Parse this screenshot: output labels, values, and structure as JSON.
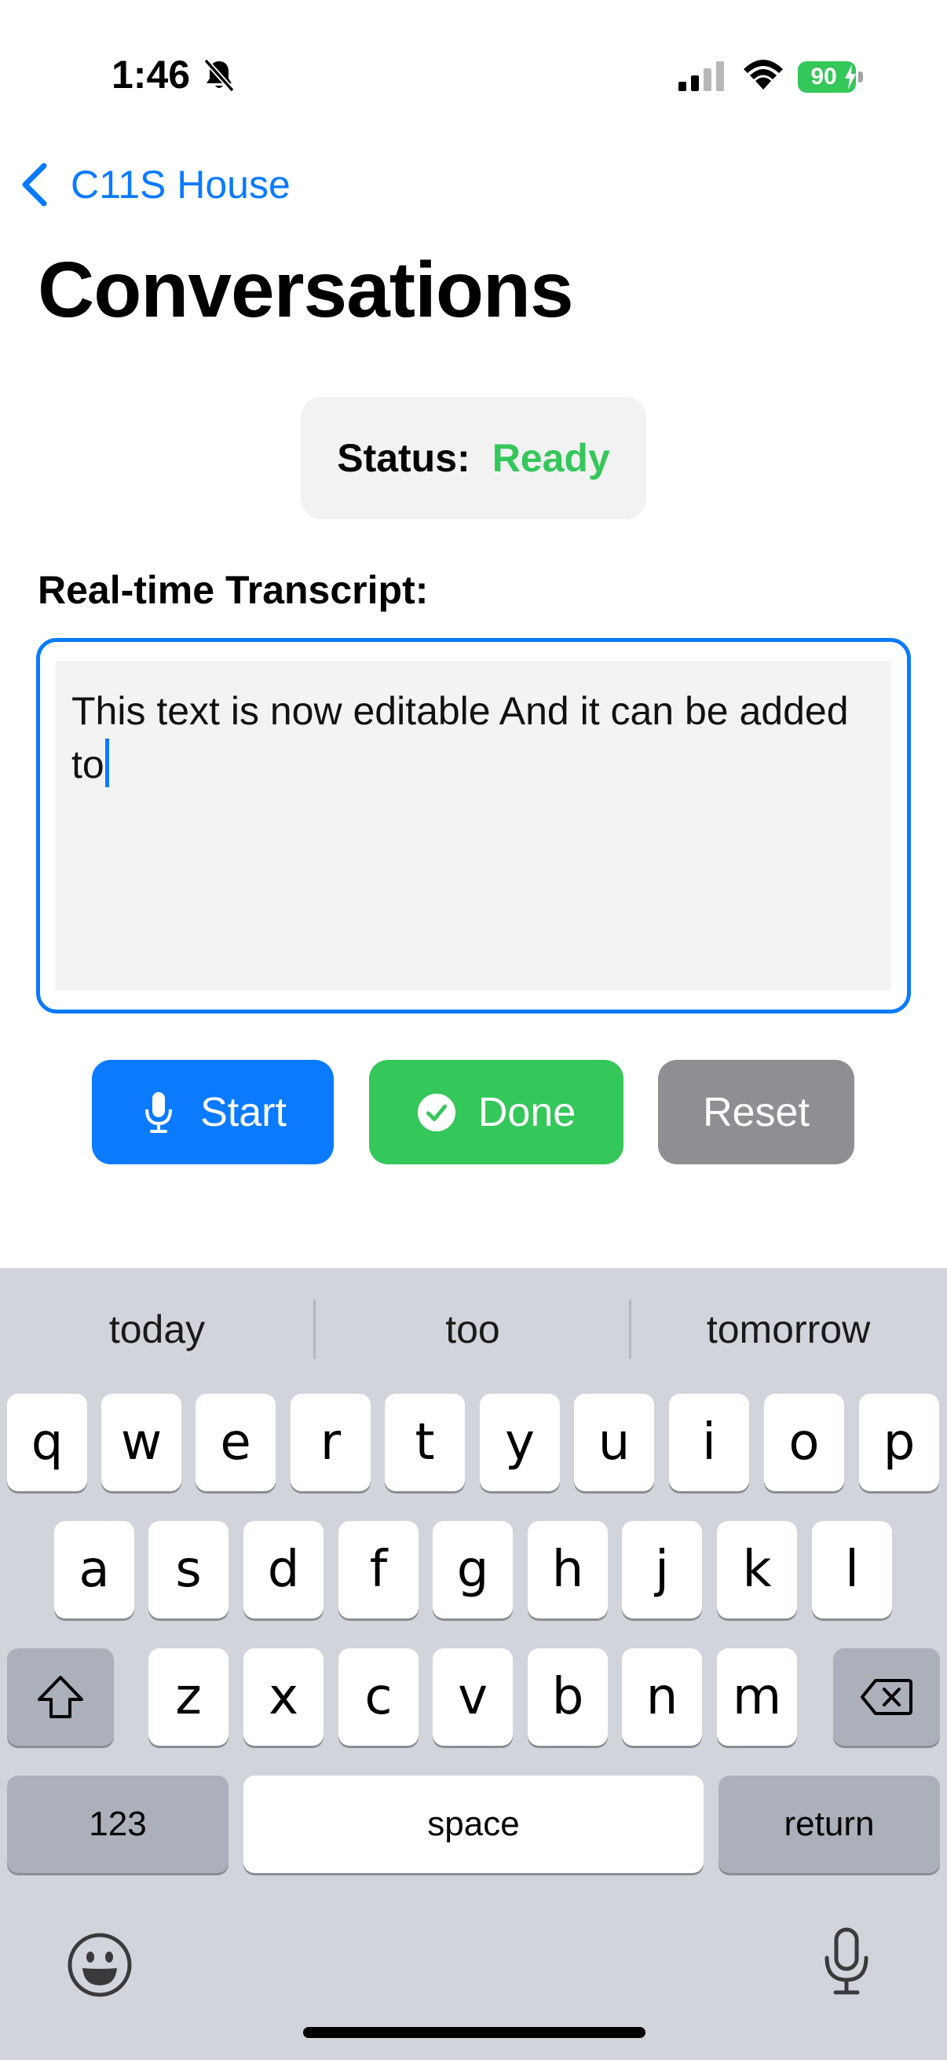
{
  "status_bar": {
    "time": "1:46",
    "battery": "90",
    "icons": [
      "bell-slash-icon",
      "signal-icon",
      "wifi-icon",
      "battery-charging-icon"
    ]
  },
  "nav": {
    "back_label": "C11S House",
    "title": "Conversations"
  },
  "status": {
    "label": "Status:",
    "value": "Ready",
    "value_color": "#34c759"
  },
  "transcript": {
    "label": "Real-time Transcript:",
    "text": "This text is now editable And it can be added to"
  },
  "buttons": {
    "start": "Start",
    "done": "Done",
    "reset": "Reset"
  },
  "keyboard": {
    "suggestions": [
      "today",
      "too",
      "tomorrow"
    ],
    "row1": [
      "q",
      "w",
      "e",
      "r",
      "t",
      "y",
      "u",
      "i",
      "o",
      "p"
    ],
    "row2": [
      "a",
      "s",
      "d",
      "f",
      "g",
      "h",
      "j",
      "k",
      "l"
    ],
    "row3": [
      "z",
      "x",
      "c",
      "v",
      "b",
      "n",
      "m"
    ],
    "numbers": "123",
    "space": "space",
    "return": "return"
  },
  "colors": {
    "accent": "#0a7aff",
    "success": "#34c759",
    "neutral": "#8e8e93",
    "keyboard_bg": "#d1d4db"
  }
}
